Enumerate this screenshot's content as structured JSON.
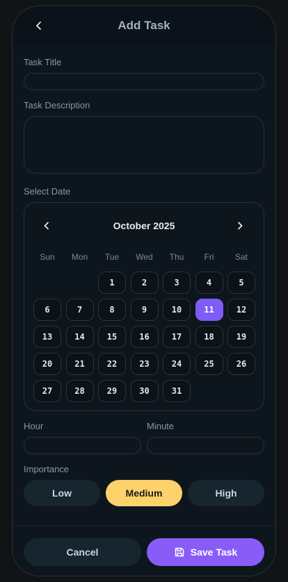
{
  "header": {
    "title": "Add Task",
    "back_icon": "chevron-left-icon"
  },
  "form": {
    "title_label": "Task Title",
    "title_value": "",
    "description_label": "Task Description",
    "description_value": "",
    "date_label": "Select Date",
    "hour_label": "Hour",
    "hour_value": "",
    "minute_label": "Minute",
    "minute_value": "",
    "importance_label": "Importance"
  },
  "calendar": {
    "month_label": "October 2025",
    "prev_icon": "chevron-left-icon",
    "next_icon": "chevron-right-icon",
    "weekdays": [
      "Sun",
      "Mon",
      "Tue",
      "Wed",
      "Thu",
      "Fri",
      "Sat"
    ],
    "first_weekday_index": 2,
    "days_in_month": 31,
    "selected_day": 11
  },
  "importance": {
    "options": [
      "Low",
      "Medium",
      "High"
    ],
    "selected": "Medium"
  },
  "footer": {
    "cancel_label": "Cancel",
    "save_label": "Save Task",
    "save_icon": "save-icon"
  },
  "colors": {
    "accent": "#8a5cf7",
    "selected_importance": "#fdd26a",
    "background": "#0e161d"
  }
}
